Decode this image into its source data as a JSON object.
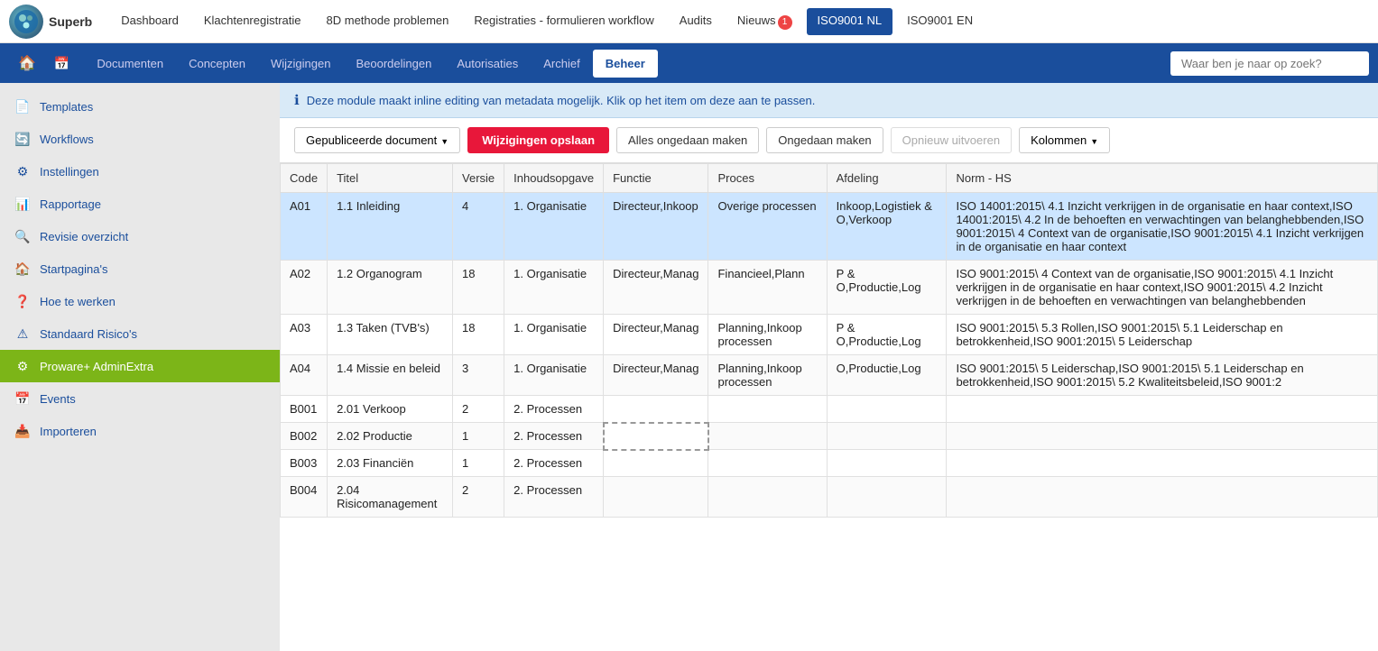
{
  "topNav": {
    "logo": "Superb",
    "items": [
      {
        "label": "Dashboard",
        "active": false
      },
      {
        "label": "Klachtenregistratie",
        "active": false
      },
      {
        "label": "8D methode problemen",
        "active": false
      },
      {
        "label": "Registraties - formulieren workflow",
        "active": false
      },
      {
        "label": "Audits",
        "active": false
      },
      {
        "label": "Nieuws",
        "active": false,
        "badge": "1"
      },
      {
        "label": "ISO9001 NL",
        "active": true
      },
      {
        "label": "ISO9001 EN",
        "active": false
      }
    ]
  },
  "secNav": {
    "items": [
      {
        "label": "Documenten",
        "active": false
      },
      {
        "label": "Concepten",
        "active": false
      },
      {
        "label": "Wijzigingen",
        "active": false
      },
      {
        "label": "Beoordelingen",
        "active": false
      },
      {
        "label": "Autorisaties",
        "active": false
      },
      {
        "label": "Archief",
        "active": false
      },
      {
        "label": "Beheer",
        "active": true
      }
    ],
    "searchPlaceholder": "Waar ben je naar op zoek?"
  },
  "sidebar": {
    "items": [
      {
        "label": "Templates",
        "icon": "📄",
        "active": false
      },
      {
        "label": "Workflows",
        "icon": "🔄",
        "active": false
      },
      {
        "label": "Instellingen",
        "icon": "⚙",
        "active": false
      },
      {
        "label": "Rapportage",
        "icon": "📊",
        "active": false
      },
      {
        "label": "Revisie overzicht",
        "icon": "🔍",
        "active": false
      },
      {
        "label": "Startpagina's",
        "icon": "🏠",
        "active": false
      },
      {
        "label": "Hoe te werken",
        "icon": "❓",
        "active": false
      },
      {
        "label": "Standaard Risico's",
        "icon": "⚠",
        "active": false
      },
      {
        "label": "Proware+ AdminExtra",
        "icon": "⚙",
        "active": true
      },
      {
        "label": "Events",
        "icon": "📅",
        "active": false
      },
      {
        "label": "Importeren",
        "icon": "📥",
        "active": false
      }
    ]
  },
  "infoBanner": "Deze module maakt inline editing van metadata mogelijk. Klik op het item om deze aan te passen.",
  "toolbar": {
    "dropdown": "Gepubliceerde document",
    "btn_save": "Wijzigingen opslaan",
    "btn_undo_all": "Alles ongedaan maken",
    "btn_undo": "Ongedaan maken",
    "btn_redo": "Opnieuw uitvoeren",
    "btn_columns": "Kolommen"
  },
  "table": {
    "columns": [
      "Code",
      "Titel",
      "Versie",
      "Inhoudsopgave",
      "Functie",
      "Proces",
      "Afdeling",
      "Norm - HS"
    ],
    "rows": [
      {
        "code": "A01",
        "titel": "1.1 Inleiding",
        "versie": "4",
        "inhoudsopgave": "1. Organisatie",
        "functie": "Directeur,Inkoop",
        "proces": "Overige processen",
        "afdeling": "Inkoop,Logistiek & O,Verkoop",
        "norm": "ISO 14001:2015\\ 4.1 Inzicht verkrijgen in de organisatie en haar context,ISO 14001:2015\\ 4.2 In de behoeften en verwachtingen van belanghebbenden,ISO 9001:2015\\ 4 Context van de organisatie,ISO 9001:2015\\ 4.1 Inzicht verkrijgen in de organisatie en haar context",
        "selected": true,
        "cellDashed": false
      },
      {
        "code": "A02",
        "titel": "1.2 Organogram",
        "versie": "18",
        "inhoudsopgave": "1. Organisatie",
        "functie": "Directeur,Manag",
        "proces": "Financieel,Plann",
        "afdeling": "P & O,Productie,Log",
        "norm": "ISO 9001:2015\\ 4 Context van de organisatie,ISO 9001:2015\\ 4.1 Inzicht verkrijgen in de organisatie en haar context,ISO 9001:2015\\ 4.2 Inzicht verkrijgen in de behoeften en verwachtingen van belanghebbenden",
        "selected": false,
        "cellDashed": false
      },
      {
        "code": "A03",
        "titel": "1.3 Taken (TVB's)",
        "versie": "18",
        "inhoudsopgave": "1. Organisatie",
        "functie": "Directeur,Manag",
        "proces": "Planning,Inkoop processen",
        "afdeling": "P & O,Productie,Log",
        "norm": "ISO 9001:2015\\ 5.3 Rollen,ISO 9001:2015\\ 5.1 Leiderschap en betrokkenheid,ISO 9001:2015\\ 5 Leiderschap",
        "selected": false,
        "cellDashed": false
      },
      {
        "code": "A04",
        "titel": "1.4 Missie en beleid",
        "versie": "3",
        "inhoudsopgave": "1. Organisatie",
        "functie": "Directeur,Manag",
        "proces": "Planning,Inkoop processen",
        "afdeling": "O,Productie,Log",
        "norm": "ISO 9001:2015\\ 5 Leiderschap,ISO 9001:2015\\ 5.1 Leiderschap en betrokkenheid,ISO 9001:2015\\ 5.2 Kwaliteitsbeleid,ISO 9001:2",
        "selected": false,
        "cellDashed": false
      },
      {
        "code": "B001",
        "titel": "2.01 Verkoop",
        "versie": "2",
        "inhoudsopgave": "2. Processen",
        "functie": "",
        "proces": "",
        "afdeling": "",
        "norm": "",
        "selected": false,
        "cellDashed": false
      },
      {
        "code": "B002",
        "titel": "2.02 Productie",
        "versie": "1",
        "inhoudsopgave": "2. Processen",
        "functie": "",
        "proces": "",
        "afdeling": "",
        "norm": "",
        "selected": false,
        "cellDashed": true
      },
      {
        "code": "B003",
        "titel": "2.03 Financiën",
        "versie": "1",
        "inhoudsopgave": "2. Processen",
        "functie": "",
        "proces": "",
        "afdeling": "",
        "norm": "",
        "selected": false,
        "cellDashed": false
      },
      {
        "code": "B004",
        "titel": "2.04 Risicomanagement",
        "versie": "2",
        "inhoudsopgave": "2. Processen",
        "functie": "",
        "proces": "",
        "afdeling": "",
        "norm": "",
        "selected": false,
        "cellDashed": false
      }
    ]
  }
}
